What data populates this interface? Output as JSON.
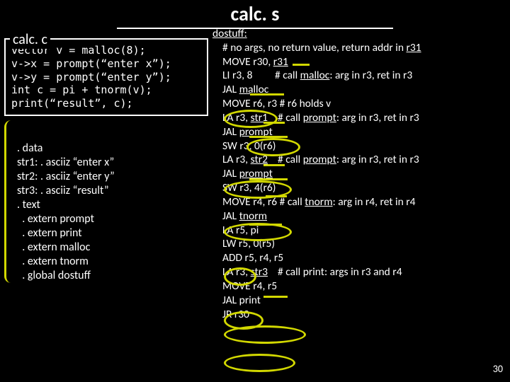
{
  "title": "calc. s",
  "calc_c": {
    "title": "calc. c",
    "lines": [
      "vector v = malloc(8);",
      "v->x = prompt(“enter x”);",
      "v->y = prompt(“enter y”);",
      "int c = pi + tnorm(v);",
      "print(“result”, c);"
    ]
  },
  "asm_data": {
    "lines": [
      ". data",
      "str1: . asciiz “enter x”",
      "str2: . asciiz “enter y”",
      "str3: . asciiz “result”",
      ". text",
      "  . extern prompt",
      "  . extern print",
      "  . extern malloc",
      "  . extern tnorm",
      "  . global dostuff"
    ]
  },
  "calc_s": {
    "label": "dostuff:",
    "lines": [
      "    # no args, no return value, return addr in r31",
      "    MOVE r30, r31",
      "    LI r3, 8         # call malloc: arg in r3, ret in r3",
      "    JAL malloc",
      "    MOVE r6, r3 # r6 holds v",
      "    LA r3, str1    # call prompt: arg in r3, ret in r3",
      "    JAL prompt",
      "    SW r3, 0(r6)",
      "    LA r3, str2    # call prompt: arg in r3, ret in r3",
      "    JAL prompt",
      "    SW r3, 4(r6)",
      "    MOVE r4, r6 # call tnorm: arg in r4, ret in r4",
      "    JAL tnorm",
      "    LA r5, pi",
      "    LW r5, 0(r5)",
      "    ADD r5, r4, r5",
      "    LA r3, str3    # call print: args in r3 and r4",
      "    MOVE r4, r5",
      "    JAL print",
      "    JR r30"
    ]
  },
  "page_number": "30",
  "underlined_targets": [
    "r31",
    "malloc",
    "str1",
    "prompt",
    "str2",
    "prompt",
    "tnorm",
    "str3"
  ]
}
